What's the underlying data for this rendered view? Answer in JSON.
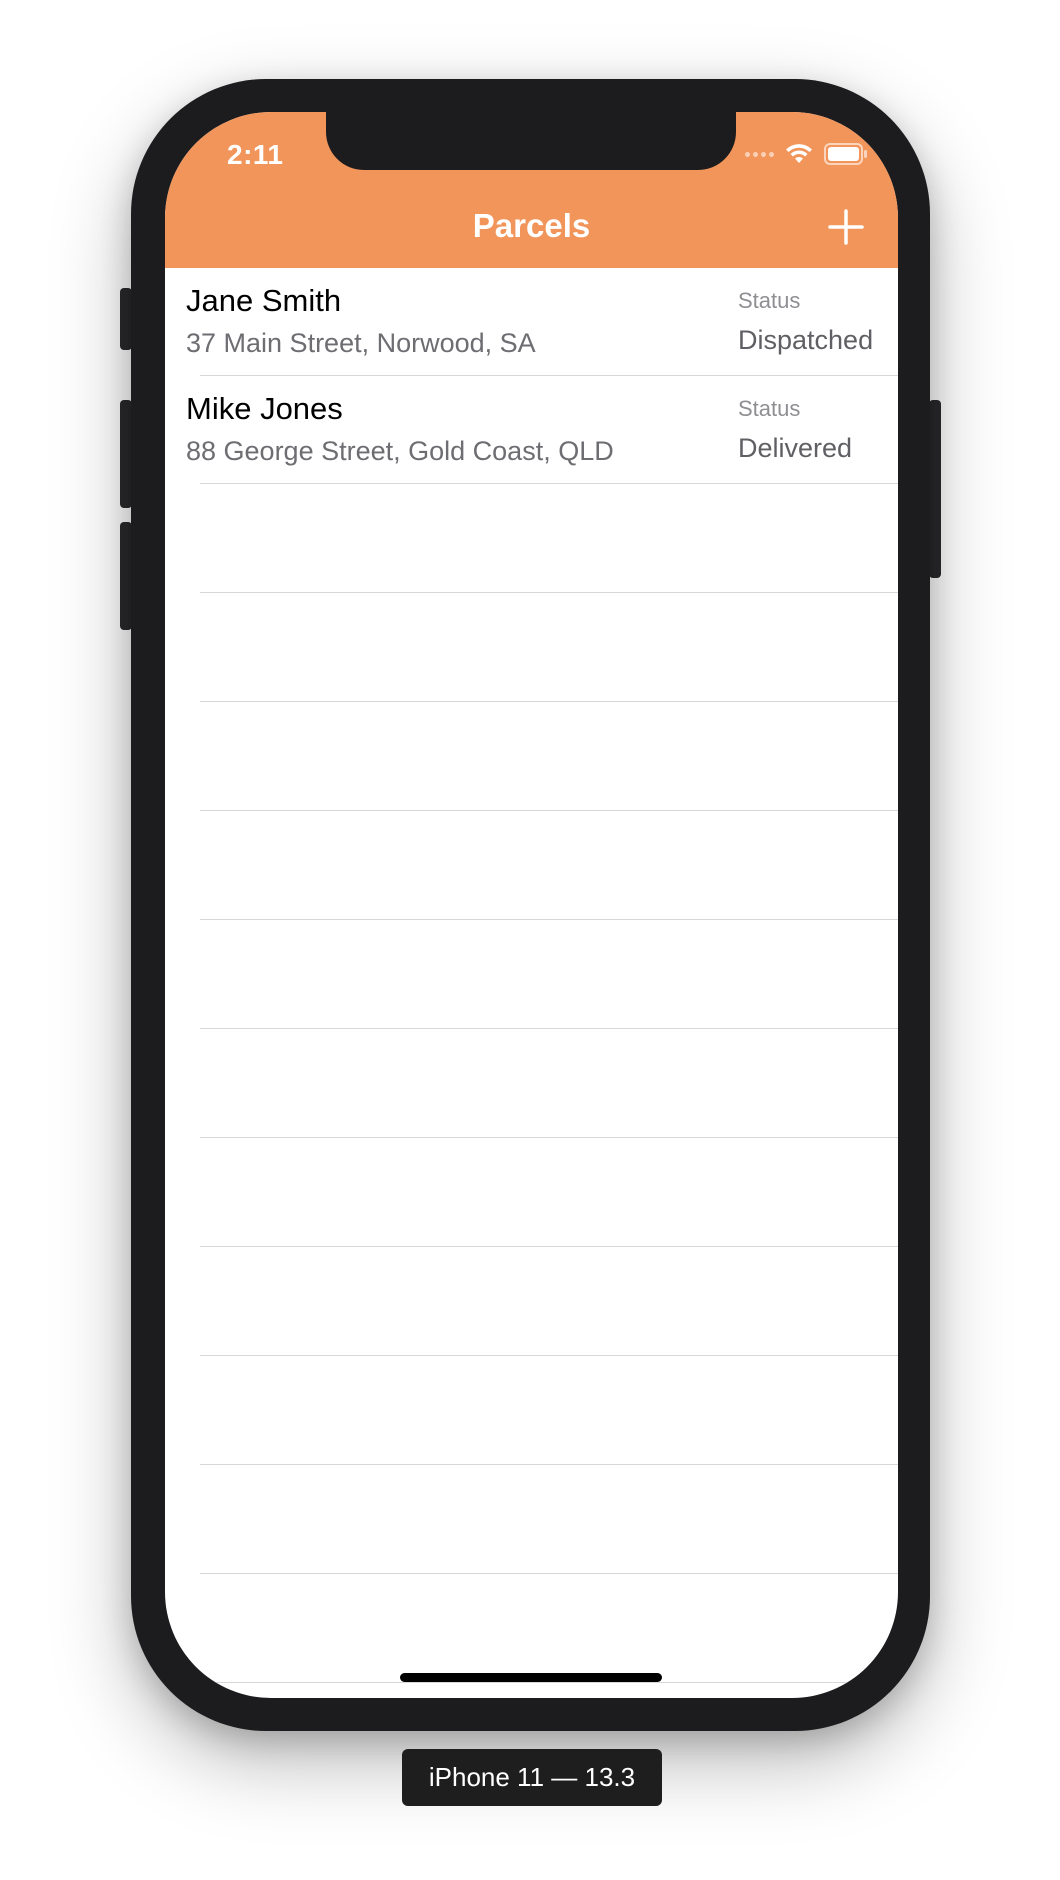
{
  "status_bar": {
    "time": "2:11"
  },
  "nav": {
    "title": "Parcels",
    "add_icon": "plus-icon",
    "bar_color": "#f2955b"
  },
  "parcels": [
    {
      "name": "Jane Smith",
      "address": "37 Main Street, Norwood, SA",
      "status_label": "Status",
      "status": "Dispatched"
    },
    {
      "name": "Mike Jones",
      "address": "88 George Street, Gold Coast, QLD",
      "status_label": "Status",
      "status": "Delivered"
    }
  ],
  "simulator_label": "iPhone 11 — 13.3"
}
